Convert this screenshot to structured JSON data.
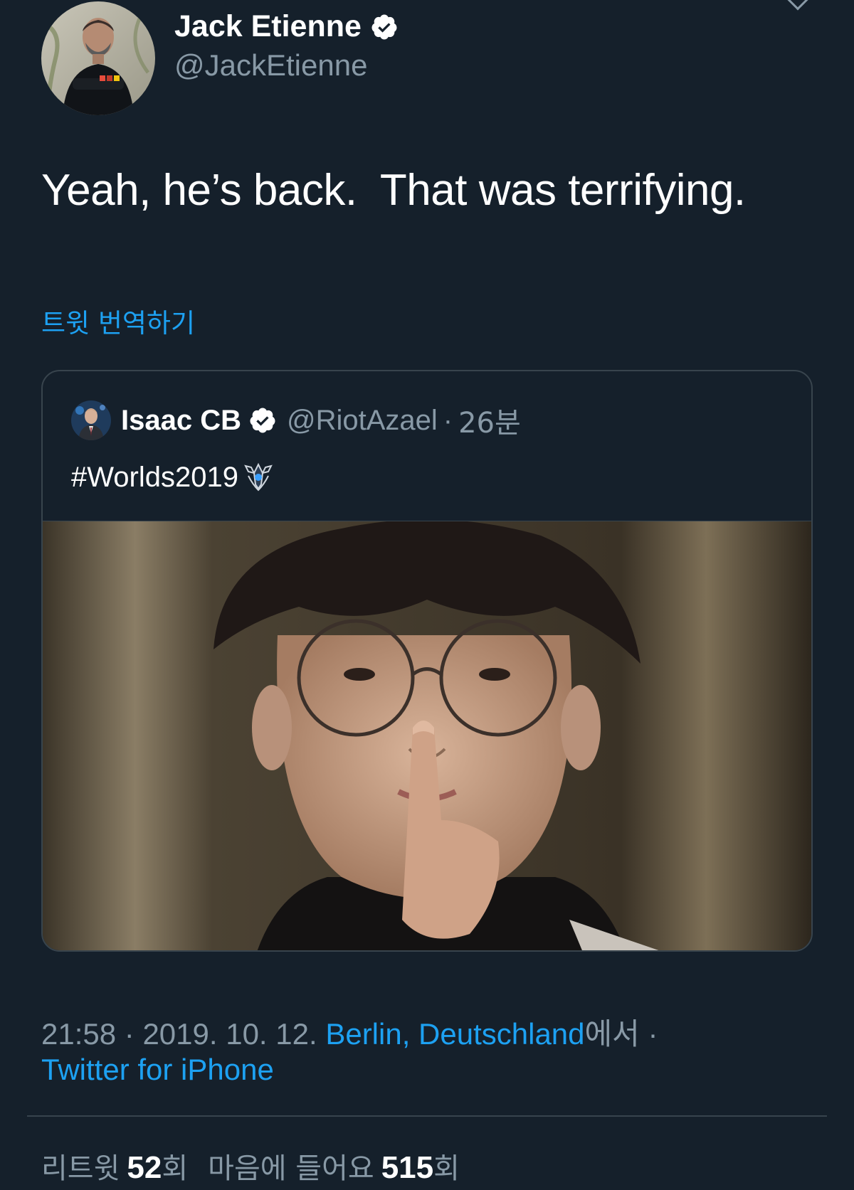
{
  "author": {
    "display_name": "Jack Etienne",
    "handle": "@JackEtienne",
    "verified": true,
    "avatar": "avatar-man-black-shirt"
  },
  "tweet": {
    "text": "Yeah, he’s back.  That was terrifying.",
    "translate_label": "트윗 번역하기"
  },
  "quoted_tweet": {
    "display_name": "Isaac CB",
    "handle": "@RiotAzael",
    "separator": "·",
    "time": "26분",
    "verified": true,
    "text": "#Worlds2019",
    "emoji_icon": "worlds-2019-logo-icon",
    "media": "photo-player-finger-on-lips"
  },
  "meta": {
    "time": "21:58",
    "sep1": " · ",
    "date": "2019. 10. 12.",
    "location": "Berlin, Deutschland",
    "location_suffix": "에서",
    "sep2": " ·",
    "source": "Twitter for iPhone"
  },
  "stats": {
    "retweets_label": "리트윗",
    "retweets_count": "52",
    "retweets_unit": "회",
    "likes_label": "마음에 들어요",
    "likes_count": "515",
    "likes_unit": "회"
  },
  "colors": {
    "background": "#15202b",
    "accent": "#1da1f2",
    "secondary_text": "#8899a6",
    "border": "#38444d"
  }
}
